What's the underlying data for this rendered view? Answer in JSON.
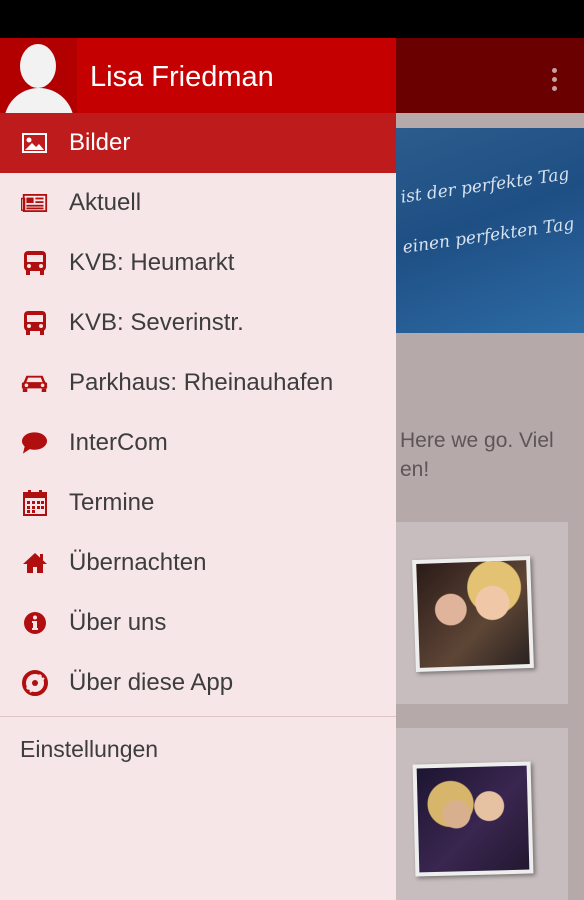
{
  "user": {
    "name": "Lisa Friedman"
  },
  "menu": {
    "items": [
      {
        "label": "Bilder",
        "icon": "image-icon",
        "active": true
      },
      {
        "label": "Aktuell",
        "icon": "newspaper-icon"
      },
      {
        "label": "KVB: Heumarkt",
        "icon": "bus-icon"
      },
      {
        "label": "KVB: Severinstr.",
        "icon": "bus-icon"
      },
      {
        "label": "Parkhaus: Rheinauhafen",
        "icon": "car-icon"
      },
      {
        "label": "InterCom",
        "icon": "chat-bubble-icon"
      },
      {
        "label": "Termine",
        "icon": "calendar-icon"
      },
      {
        "label": "Übernachten",
        "icon": "home-icon"
      },
      {
        "label": "Über uns",
        "icon": "info-icon"
      },
      {
        "label": "Über diese App",
        "icon": "app-logo-icon"
      }
    ],
    "settings_label": "Einstellungen"
  },
  "background": {
    "banner_line1": "ist der perfekte Tag",
    "banner_line2": "einen perfekten Tag",
    "post_line1": "Here we go. Viel",
    "post_line2": "en!"
  },
  "colors": {
    "accent": "#c40000",
    "drawer_bg": "#f6e6e7",
    "active_item": "#be1c1c"
  }
}
